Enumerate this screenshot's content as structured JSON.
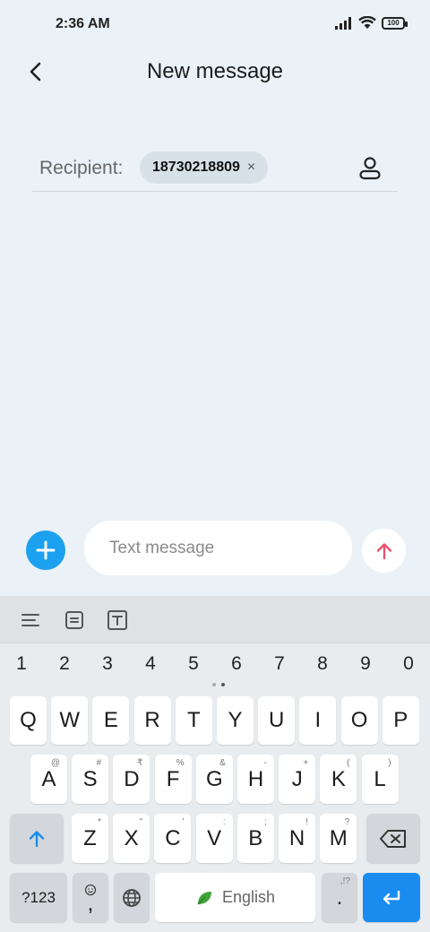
{
  "status_bar": {
    "time": "2:36 AM",
    "battery": "100"
  },
  "header": {
    "title": "New message"
  },
  "recipient": {
    "label": "Recipient:",
    "chip": "18730218809",
    "chip_close": "×"
  },
  "compose": {
    "placeholder": "Text message"
  },
  "colors": {
    "accent": "#1ba1f0",
    "send_arrow": "#e8506b",
    "enter_key": "#1a8cf0",
    "leaf": "#3fa53a"
  },
  "keyboard": {
    "numbers": [
      "1",
      "2",
      "3",
      "4",
      "5",
      "6",
      "7",
      "8",
      "9",
      "0"
    ],
    "row1": [
      "Q",
      "W",
      "E",
      "R",
      "T",
      "Y",
      "U",
      "I",
      "O",
      "P"
    ],
    "row2": [
      {
        "k": "A",
        "h": "@"
      },
      {
        "k": "S",
        "h": "#"
      },
      {
        "k": "D",
        "h": "₹"
      },
      {
        "k": "F",
        "h": "%"
      },
      {
        "k": "G",
        "h": "&"
      },
      {
        "k": "H",
        "h": "-"
      },
      {
        "k": "J",
        "h": "+"
      },
      {
        "k": "K",
        "h": "("
      },
      {
        "k": "L",
        "h": ")"
      }
    ],
    "row3": [
      {
        "k": "Z",
        "h": "*"
      },
      {
        "k": "X",
        "h": "\""
      },
      {
        "k": "C",
        "h": "'"
      },
      {
        "k": "V",
        "h": ":"
      },
      {
        "k": "B",
        "h": ";"
      },
      {
        "k": "N",
        "h": "!"
      },
      {
        "k": "M",
        "h": "?"
      }
    ],
    "symbols_label": "?123",
    "comma": ",",
    "space_label": "English",
    "period": ".",
    "period_hint": ",!?"
  }
}
